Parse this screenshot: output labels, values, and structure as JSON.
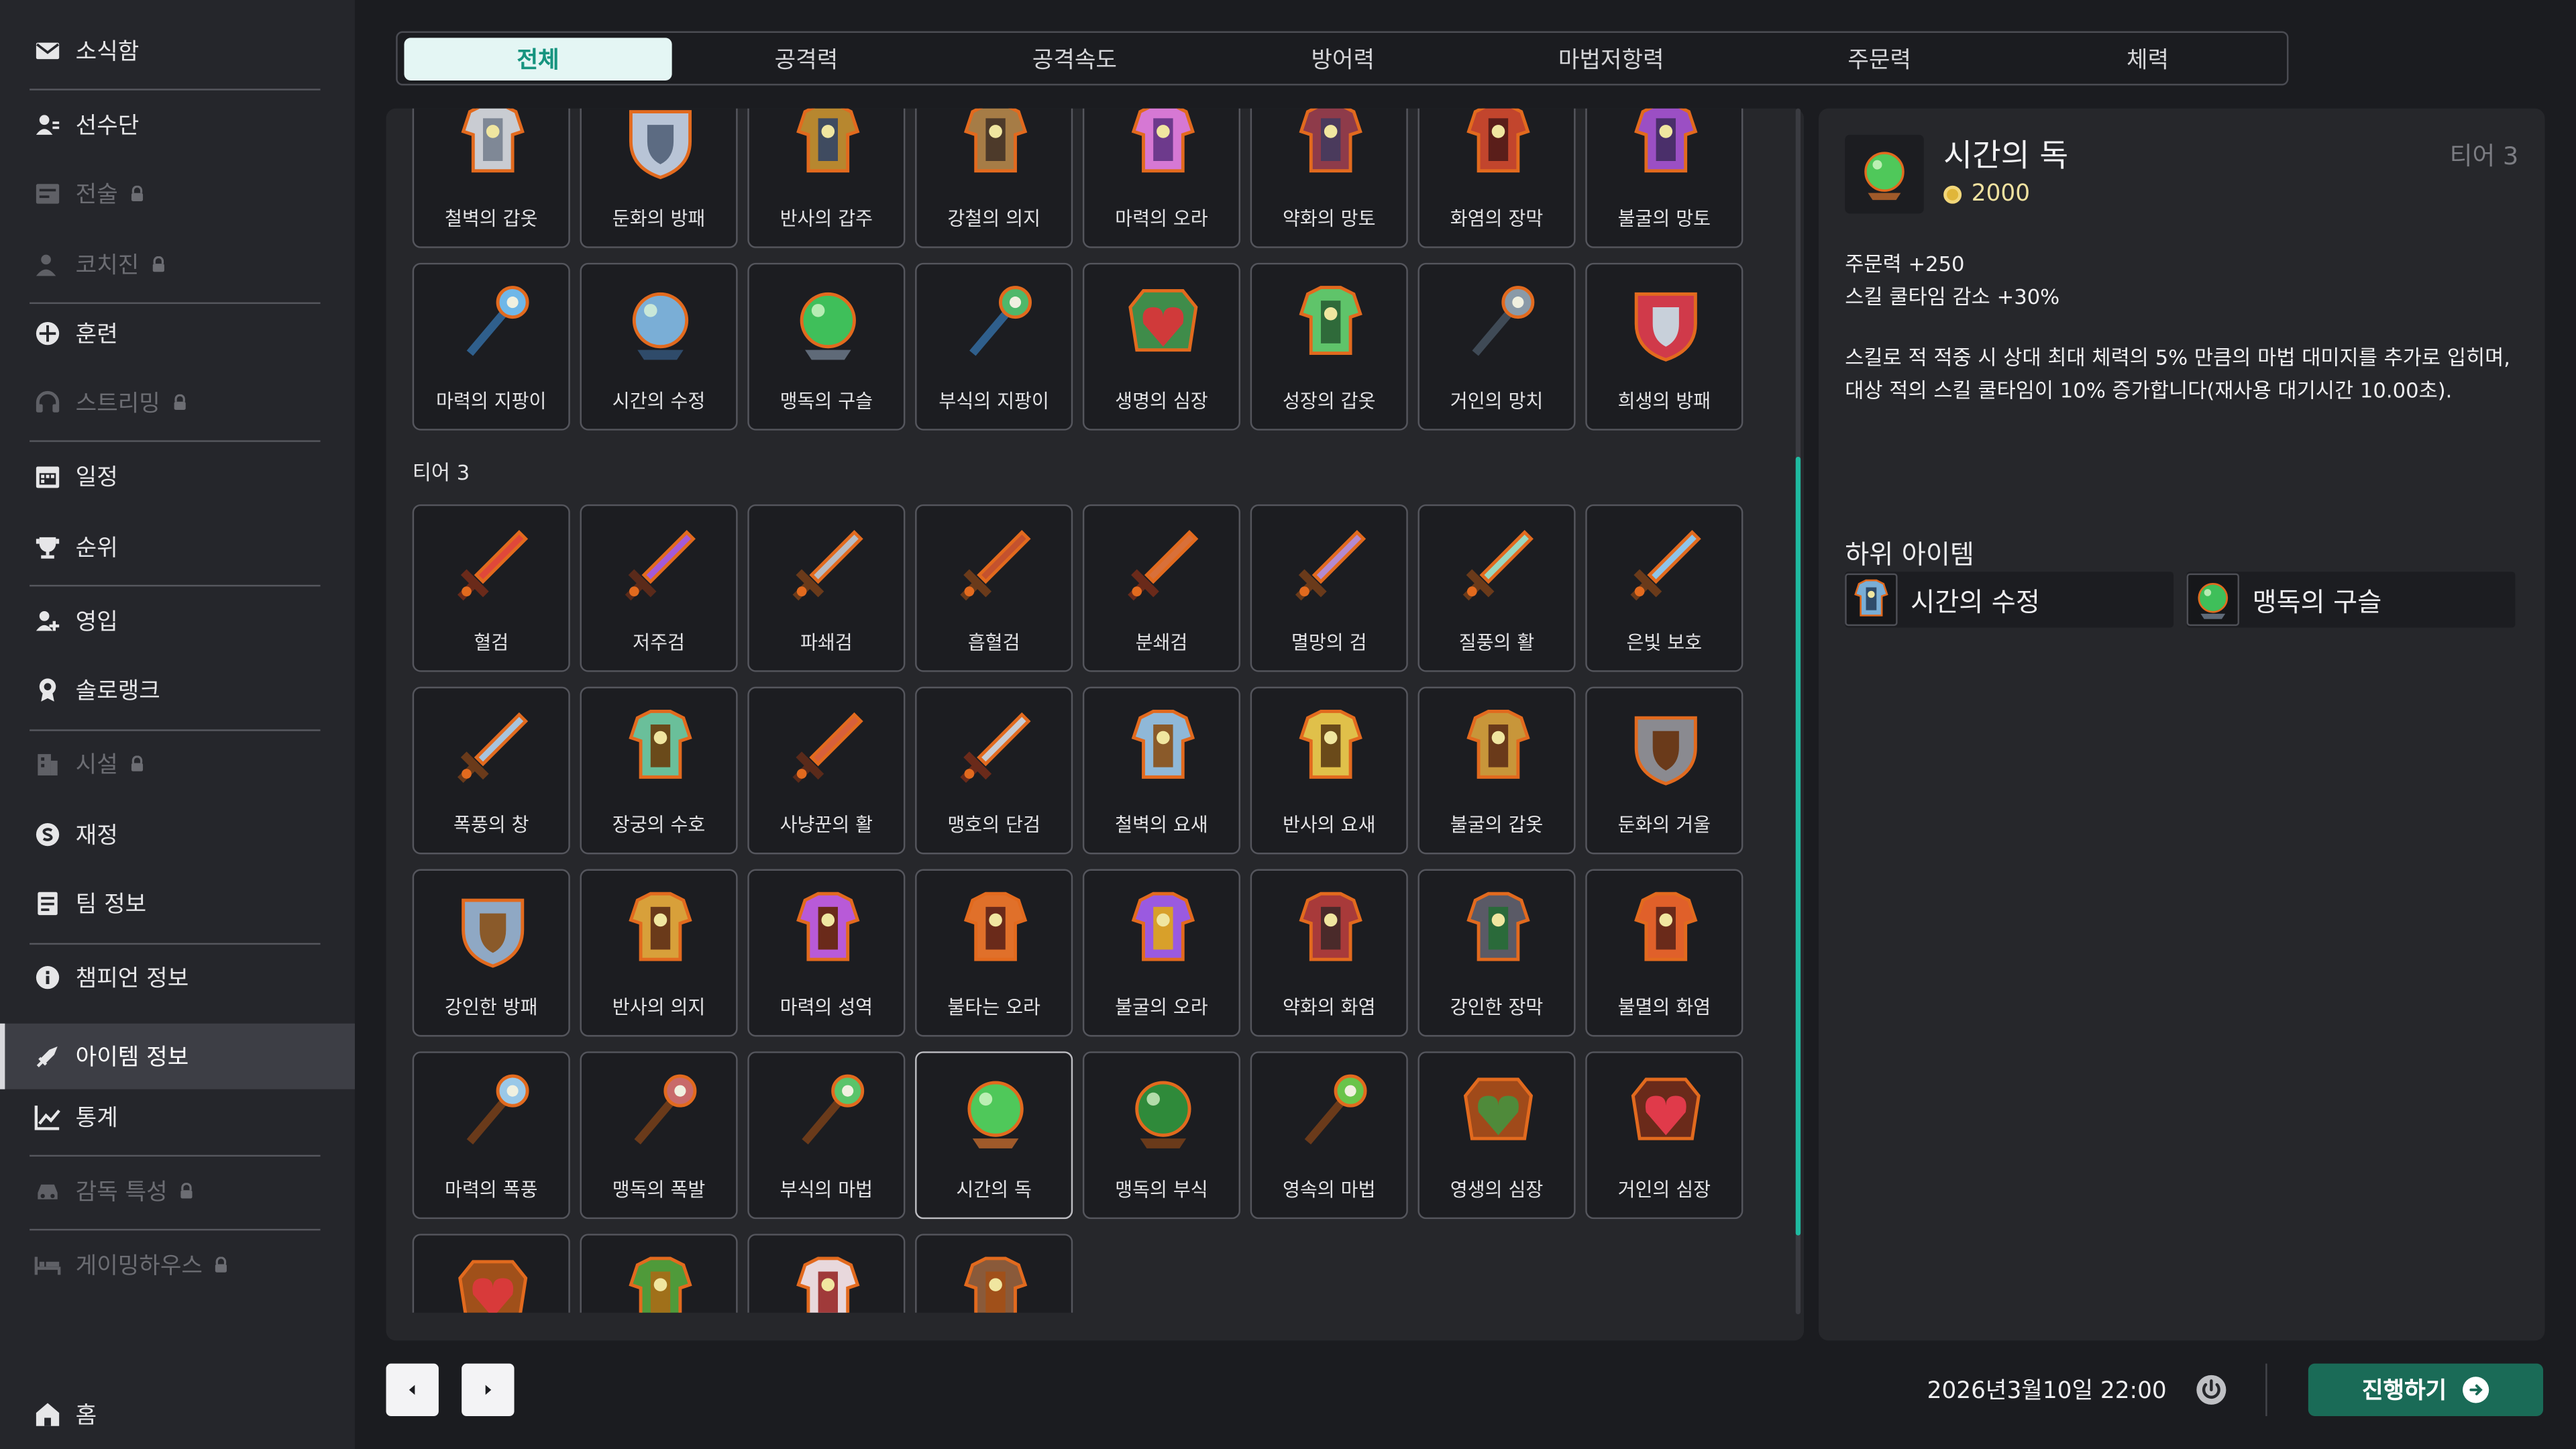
{
  "sidebar": {
    "items": [
      {
        "label": "소식함",
        "icon": "mail-icon",
        "locked": false,
        "active": false
      },
      {
        "label": "선수단",
        "icon": "roster-icon",
        "locked": false,
        "active": false
      },
      {
        "label": "전술",
        "icon": "tactics-icon",
        "locked": true,
        "active": false
      },
      {
        "label": "코치진",
        "icon": "coach-icon",
        "locked": true,
        "active": false
      },
      {
        "label": "훈련",
        "icon": "training-icon",
        "locked": false,
        "active": false
      },
      {
        "label": "스트리밍",
        "icon": "headset-icon",
        "locked": true,
        "active": false
      },
      {
        "label": "일정",
        "icon": "calendar-icon",
        "locked": false,
        "active": false
      },
      {
        "label": "순위",
        "icon": "trophy-icon",
        "locked": false,
        "active": false
      },
      {
        "label": "영입",
        "icon": "recruit-icon",
        "locked": false,
        "active": false
      },
      {
        "label": "솔로랭크",
        "icon": "medal-icon",
        "locked": false,
        "active": false
      },
      {
        "label": "시설",
        "icon": "building-icon",
        "locked": true,
        "active": false
      },
      {
        "label": "재정",
        "icon": "money-icon",
        "locked": false,
        "active": false
      },
      {
        "label": "팀 정보",
        "icon": "team-info-icon",
        "locked": false,
        "active": false
      },
      {
        "label": "챔피언 정보",
        "icon": "info-icon",
        "locked": false,
        "active": false
      },
      {
        "label": "아이템 정보",
        "icon": "sword-icon",
        "locked": false,
        "active": true
      },
      {
        "label": "통계",
        "icon": "chart-icon",
        "locked": false,
        "active": false
      },
      {
        "label": "감독 특성",
        "icon": "car-icon",
        "locked": true,
        "active": false
      },
      {
        "label": "게이밍하우스",
        "icon": "bed-icon",
        "locked": true,
        "active": false
      }
    ],
    "home_label": "홈"
  },
  "tabs": [
    "전체",
    "공격력",
    "공격속도",
    "방어력",
    "마법저항력",
    "주문력",
    "체력"
  ],
  "active_tab": 0,
  "grid": {
    "rows": [
      {
        "items": [
          {
            "name": "철벽의 갑옷",
            "c1": "#c9ccd2",
            "c2": "#7f8896"
          },
          {
            "name": "둔화의 방패",
            "c1": "#b8c4d6",
            "c2": "#5c6b82"
          },
          {
            "name": "반사의 갑주",
            "c1": "#b7872f",
            "c2": "#3f4b60"
          },
          {
            "name": "강철의 의지",
            "c1": "#a67c46",
            "c2": "#4d3a2a"
          },
          {
            "name": "마력의 오라",
            "c1": "#d678d4",
            "c2": "#6d3a8c"
          },
          {
            "name": "약화의 망토",
            "c1": "#8e3b4a",
            "c2": "#4a3a5c"
          },
          {
            "name": "화염의 장막",
            "c1": "#c2452d",
            "c2": "#5a1e1a"
          },
          {
            "name": "불굴의 망토",
            "c1": "#9b4fc4",
            "c2": "#4a2f6a"
          }
        ]
      },
      {
        "items": [
          {
            "name": "마력의 지팡이",
            "c1": "#6fb7e8",
            "c2": "#2f5f8c"
          },
          {
            "name": "시간의 수정",
            "c1": "#7aaed6",
            "c2": "#2f4b6a"
          },
          {
            "name": "맹독의 구슬",
            "c1": "#3fbf5a",
            "c2": "#5f6a78"
          },
          {
            "name": "부식의 지팡이",
            "c1": "#4fb86a",
            "c2": "#2f5f8c"
          },
          {
            "name": "생명의 심장",
            "c1": "#d03a3a",
            "c2": "#3f8c4a"
          },
          {
            "name": "성장의 갑옷",
            "c1": "#5fc46a",
            "c2": "#2f6a3a"
          },
          {
            "name": "거인의 망치",
            "c1": "#8a9aa8",
            "c2": "#3f4a56"
          },
          {
            "name": "희생의 방패",
            "c1": "#d03a4a",
            "c2": "#c8d0da"
          }
        ]
      }
    ],
    "section_label": "티어 3",
    "tier3_rows": [
      {
        "items": [
          {
            "name": "혈검",
            "c1": "#e0483a",
            "c2": "#6a2a1a"
          },
          {
            "name": "저주검",
            "c1": "#a45ad8",
            "c2": "#5a2a1a"
          },
          {
            "name": "파쇄검",
            "c1": "#b8bcc4",
            "c2": "#6a3a1a"
          },
          {
            "name": "흡혈검",
            "c1": "#c4522e",
            "c2": "#6a3a1a"
          },
          {
            "name": "분쇄검",
            "c1": "#d8703a",
            "c2": "#6a2a1a"
          },
          {
            "name": "멸망의 검",
            "c1": "#b48ad0",
            "c2": "#6a3a1a"
          },
          {
            "name": "질풍의 활",
            "c1": "#9ad8c0",
            "c2": "#6a3a1a"
          },
          {
            "name": "은빛 보호",
            "c1": "#8fc4e8",
            "c2": "#6a3a1a"
          }
        ]
      },
      {
        "items": [
          {
            "name": "폭풍의 창",
            "c1": "#a8c4dc",
            "c2": "#6a3a1a"
          },
          {
            "name": "장궁의 수호",
            "c1": "#6abf9a",
            "c2": "#6a4a1a"
          },
          {
            "name": "사냥꾼의 활",
            "c1": "#d8603a",
            "c2": "#5a2a1a"
          },
          {
            "name": "맹호의 단검",
            "c1": "#c8ccd4",
            "c2": "#6a2a1a"
          },
          {
            "name": "철벽의 요새",
            "c1": "#8fb8d8",
            "c2": "#8a5a2a"
          },
          {
            "name": "반사의 요새",
            "c1": "#e0c04a",
            "c2": "#6a4a1a"
          },
          {
            "name": "불굴의 갑옷",
            "c1": "#c8963a",
            "c2": "#6a3a1a"
          },
          {
            "name": "둔화의 거울",
            "c1": "#8a8a90",
            "c2": "#6a3a1a"
          }
        ]
      },
      {
        "items": [
          {
            "name": "강인한 방패",
            "c1": "#8fa8c4",
            "c2": "#8a5a2a"
          },
          {
            "name": "반사의 의지",
            "c1": "#d8a03a",
            "c2": "#6a3a1a"
          },
          {
            "name": "마력의 성역",
            "c1": "#b85ad8",
            "c2": "#6a2a1a"
          },
          {
            "name": "불타는 오라",
            "c1": "#e0702a",
            "c2": "#6a2a1a"
          },
          {
            "name": "불굴의 오라",
            "c1": "#9a5ae0",
            "c2": "#d8a02a"
          },
          {
            "name": "약화의 화염",
            "c1": "#a83a3a",
            "c2": "#4a2a2a"
          },
          {
            "name": "강인한 장막",
            "c1": "#5a5a66",
            "c2": "#2a6a3a"
          },
          {
            "name": "불멸의 화염",
            "c1": "#e0602a",
            "c2": "#6a2a1a"
          }
        ]
      },
      {
        "items": [
          {
            "name": "마력의 폭풍",
            "c1": "#9ac8e8",
            "c2": "#6a3a1a"
          },
          {
            "name": "맹독의 폭발",
            "c1": "#c86a6a",
            "c2": "#6a3a1a"
          },
          {
            "name": "부식의 마법",
            "c1": "#5ac46a",
            "c2": "#6a3a1a"
          },
          {
            "name": "시간의 독",
            "c1": "#4fc85a",
            "c2": "#a05a2a"
          },
          {
            "name": "맹독의 부식",
            "c1": "#2f8a3a",
            "c2": "#6a3a1a"
          },
          {
            "name": "영속의 마법",
            "c1": "#6ac44a",
            "c2": "#6a3a1a"
          },
          {
            "name": "영생의 심장",
            "c1": "#4f8a3a",
            "c2": "#a04a1a"
          },
          {
            "name": "거인의 심장",
            "c1": "#e03a4a",
            "c2": "#6a2a1a"
          }
        ]
      },
      {
        "items": [
          {
            "name": "",
            "c1": "#d83a3a",
            "c2": "#a0501a"
          },
          {
            "name": "",
            "c1": "#4f9a3a",
            "c2": "#a0701a"
          },
          {
            "name": "",
            "c1": "#e8d8dc",
            "c2": "#a03a3a"
          },
          {
            "name": "",
            "c1": "#8a5a3a",
            "c2": "#a0501a"
          }
        ]
      }
    ],
    "selected_item": "시간의 독"
  },
  "detail": {
    "name": "시간의 독",
    "tier": "티어 3",
    "cost": "2000",
    "stats": [
      "주문력 +250",
      "스킬 쿨타임 감소 +30%"
    ],
    "description": "스킬로 적 적중 시 상대 최대 체력의 5% 만큼의 마법 대미지를 추가로 입히며, 대상 적의 스킬 쿨타임이 10% 증가합니다(재사용 대기시간 10.00초).",
    "sub_title": "하위 아이템",
    "sub_items": [
      {
        "name": "시간의 수정",
        "c1": "#7aaed6",
        "c2": "#2f4b6a"
      },
      {
        "name": "맹독의 구슬",
        "c1": "#3fbf5a",
        "c2": "#5f6a78"
      }
    ]
  },
  "footer": {
    "datetime": "2026년3월10일 22:00",
    "proceed_label": "진행하기"
  },
  "colors": {
    "accent": "#1fbaa0",
    "proceed": "#1a6b57",
    "active_tab_text": "#16947f"
  }
}
